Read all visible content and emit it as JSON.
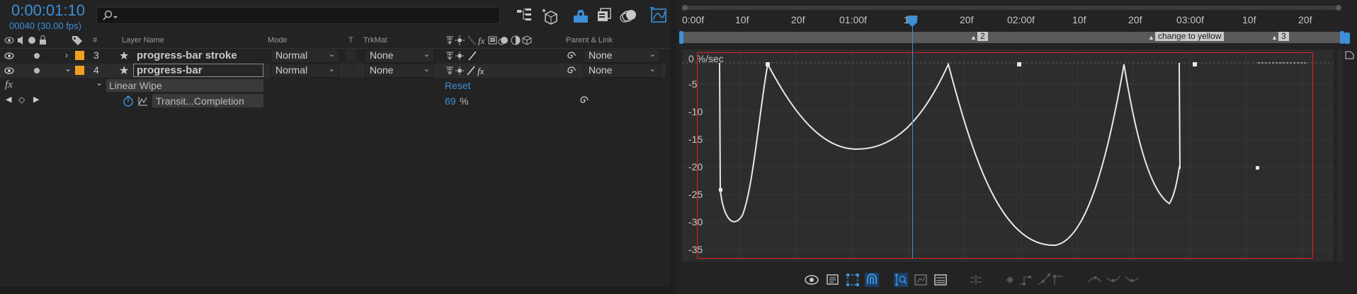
{
  "header": {
    "timecode": "0:00:01:10",
    "frames": "00040 (30.00 fps)"
  },
  "columns": {
    "number": "#",
    "layer_name": "Layer Name",
    "mode": "Mode",
    "t": "T",
    "trkmat": "TrkMat",
    "parent_link": "Parent & Link"
  },
  "layers": [
    {
      "number": "3",
      "name": "progress-bar stroke",
      "mode": "Normal",
      "trkmat": "None",
      "parent": "None",
      "color": "#f0a020"
    },
    {
      "number": "4",
      "name": "progress-bar",
      "mode": "Normal",
      "trkmat": "None",
      "parent": "None",
      "color": "#f0a020"
    }
  ],
  "effect": {
    "fx": "fx",
    "name": "Linear Wipe",
    "reset": "Reset",
    "property": "Transit...Completion",
    "value": "69",
    "unit": "%"
  },
  "ruler": {
    "ticks": [
      "0:00f",
      "10f",
      "20f",
      "01:00f",
      "10f",
      "20f",
      "02:00f",
      "10f",
      "20f",
      "03:00f",
      "10f",
      "20f"
    ]
  },
  "markers": [
    {
      "label": "2"
    },
    {
      "label": "change to yellow"
    },
    {
      "label": "3"
    }
  ],
  "graph": {
    "unit_label": "0 %/sec",
    "y_ticks": [
      "-5",
      "-10",
      "-15",
      "-20",
      "-25",
      "-30",
      "-35"
    ]
  },
  "colors": {
    "accent": "#3d8fd8",
    "label_orange": "#f0a020",
    "frame_red": "#e02020",
    "curve": "#e8e8e8",
    "work_area_green": "#22c022"
  }
}
